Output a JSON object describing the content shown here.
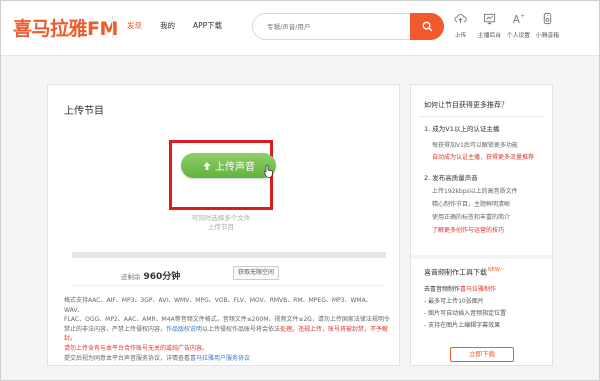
{
  "header": {
    "logo": "喜马拉雅FM",
    "nav": [
      "发现",
      "我的",
      "APP下载"
    ],
    "search_placeholder": "专辑/声音/用户",
    "tools": [
      {
        "label": "上传",
        "icon": "cloud-upload-icon"
      },
      {
        "label": "主播后台",
        "icon": "studio-icon"
      },
      {
        "label": "个人设置",
        "icon": "settings-icon"
      },
      {
        "label": "小雅音箱",
        "icon": "speaker-icon"
      }
    ],
    "accent": "#f15a2b"
  },
  "main": {
    "title": "上传节目",
    "upload_label": "上传声音",
    "hint1": "可同时选择多个文件",
    "hint2": "上传节目",
    "remain_label": "还剩余",
    "remain_value": "960分钟",
    "expand_label": "获取无限空间",
    "desc": {
      "l1": "格式支持AAC、AIF、MP3、3GP、AVI、WMV、MPG、VOB、FLV、MOV、RMVB、RM、MPEG、MP3、WMA、WAV、",
      "l2": "FLAC、OGG、MP2、AAC、AMR、M4A等音频文件格式，音频文件≤200M，视频文件≤2G，请勿上传国家法律法规明令",
      "l3a": "禁止的非法内容，严禁上传侵权内容，",
      "l3b": "作品版权说明",
      "l3c": "以上传侵权作品账号将会依法",
      "l3r": "处理。违规上传，账号将被封禁，不予解封。",
      "l4": "请勿上传含有与本平台合作账号无关的或纯广告内容。",
      "l5a": "提交后视为同意本平台声音服务协议，详情查看",
      "l5b": "喜马拉雅用户服务协议"
    }
  },
  "side": {
    "heading": "如何让节目获得更多推荐？",
    "s1_title": "1. 成为V1以上的认证主播",
    "s1_sub1": "每获得加V1后可以解锁更多功能",
    "s1_sub2": "自动成为认证主播，获得更多流量推荐",
    "s2_title": "2. 发布高质量声音",
    "s2_sub1": "上传192kbps以上的高音质文件",
    "s2_sub2": "精心制作节目，主题鲜明清晰",
    "s2_sub3": "使用正确的标签和丰富的简介",
    "s2_sub4": "了解更多创作与运营的技巧",
    "tools_heading": "喜音频制作工具下载",
    "tools_new": "NEW~",
    "t1a": "去喜音频制作",
    "t1b": "喜马拉雅制作",
    "t2": "- 最多可上传10张图片",
    "t3": "- 图片可自动插入音频指定位置",
    "t4": "- 支持在图片上编辑字幕效果",
    "download_label": "立即下载"
  }
}
